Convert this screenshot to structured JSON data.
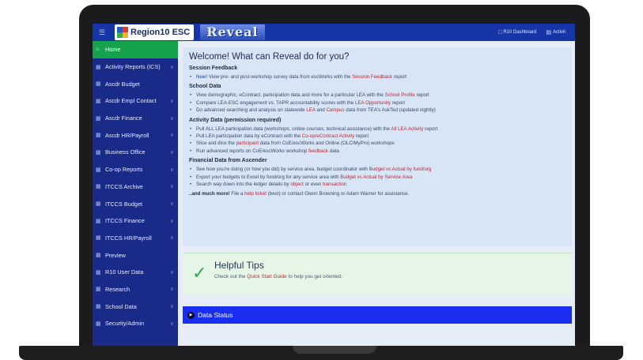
{
  "header": {
    "logo_text": "Region10 ESC",
    "brand": "Reveal",
    "links": [
      {
        "label": "R10 Dashboard",
        "icon": "dashboard-icon"
      },
      {
        "label": "Activit",
        "icon": "activity-icon"
      }
    ],
    "colors": {
      "header_bg": "#1636a8",
      "sidebar_bg": "#1a2a88",
      "active_green": "#14a34c",
      "link_red": "#c42630",
      "status_blue": "#1a2ef2"
    }
  },
  "sidebar": {
    "items": [
      {
        "label": "Home",
        "icon": "home-icon",
        "active": true
      },
      {
        "label": "Activity Reports (ICS)",
        "icon": "grid-icon",
        "chevron": true
      },
      {
        "label": "Ascdr Budget",
        "icon": "grid-icon",
        "chevron": false
      },
      {
        "label": "Ascdr Empl Contact",
        "icon": "grid-icon",
        "chevron": true
      },
      {
        "label": "Ascdr Finance",
        "icon": "grid-icon",
        "chevron": true
      },
      {
        "label": "Ascdr HR/Payroll",
        "icon": "grid-icon",
        "chevron": true
      },
      {
        "label": "Business Office",
        "icon": "grid-icon",
        "chevron": true
      },
      {
        "label": "Co-op Reports",
        "icon": "grid-icon",
        "chevron": true
      },
      {
        "label": "ITCCS Archive",
        "icon": "grid-icon",
        "chevron": true
      },
      {
        "label": "ITCCS Budget",
        "icon": "grid-icon",
        "chevron": true
      },
      {
        "label": "ITCCS Finance",
        "icon": "grid-icon",
        "chevron": true
      },
      {
        "label": "ITCCS HR/Payroll",
        "icon": "grid-icon",
        "chevron": true
      },
      {
        "label": "Preview",
        "icon": "grid-icon",
        "chevron": false
      },
      {
        "label": "R10 User Data",
        "icon": "grid-icon",
        "chevron": true
      },
      {
        "label": "Research",
        "icon": "grid-icon",
        "chevron": true
      },
      {
        "label": "School Data",
        "icon": "grid-icon",
        "chevron": true
      },
      {
        "label": "Security/Admin",
        "icon": "grid-icon",
        "chevron": true
      }
    ]
  },
  "welcome": {
    "title": "Welcome! What can Reveal do for you?",
    "sections": [
      {
        "heading": "Session Feedback",
        "items": [
          {
            "parts": [
              {
                "t": "New!",
                "s": "blue"
              },
              {
                "t": " View pre- and post-workshop survey data from escWorks with the "
              },
              {
                "t": "Session Feedback",
                "s": "red"
              },
              {
                "t": " report"
              }
            ]
          }
        ]
      },
      {
        "heading": "School Data",
        "items": [
          {
            "parts": [
              {
                "t": "View demographic, eContract, participation data and more for a particular LEA with the "
              },
              {
                "t": "School Profile",
                "s": "red"
              },
              {
                "t": " report"
              }
            ]
          },
          {
            "parts": [
              {
                "t": "Compare LEA-ESC engagement vs. TAPR accountability scores with the "
              },
              {
                "t": "LEA Opportunity",
                "s": "red"
              },
              {
                "t": " report"
              }
            ]
          },
          {
            "parts": [
              {
                "t": "Do advanced searching and analysis on statewide "
              },
              {
                "t": "LEA",
                "s": "red"
              },
              {
                "t": " and "
              },
              {
                "t": "Campus",
                "s": "red"
              },
              {
                "t": " data from TEA's AskTed (updated nightly)"
              }
            ]
          }
        ]
      },
      {
        "heading": "Activity Data (permission required)",
        "items": [
          {
            "parts": [
              {
                "t": "Pull ALL LEA participation data (workshops, online courses, technical assistance) with the "
              },
              {
                "t": "All LEA Activity",
                "s": "red"
              },
              {
                "t": " report"
              }
            ]
          },
          {
            "parts": [
              {
                "t": "Pull LEA participation data by eContract with the "
              },
              {
                "t": "Co-op/eContract Activity",
                "s": "red"
              },
              {
                "t": " report"
              }
            ]
          },
          {
            "parts": [
              {
                "t": "Slice and dice the "
              },
              {
                "t": "participant",
                "s": "red"
              },
              {
                "t": " data from CoE/escWorks and Online (OLC/MyPro) workshops"
              }
            ]
          },
          {
            "parts": [
              {
                "t": "Run advanced reports on CoE/escWorks workshop "
              },
              {
                "t": "feedback",
                "s": "red"
              },
              {
                "t": " data"
              }
            ]
          }
        ]
      },
      {
        "heading": "Financial Data from Ascender",
        "items": [
          {
            "parts": [
              {
                "t": "See how you're doing (or how you did) by service area, budget coordinator with "
              },
              {
                "t": "Budget vs Actual by fund/org",
                "s": "red"
              }
            ]
          },
          {
            "parts": [
              {
                "t": "Export your budgets to Excel by fund/org for any service area with "
              },
              {
                "t": "Budget vs Actual by Service Area",
                "s": "red"
              }
            ]
          },
          {
            "parts": [
              {
                "t": "Search way down into the ledger details by "
              },
              {
                "t": "object",
                "s": "red"
              },
              {
                "t": " or even "
              },
              {
                "t": "transaction",
                "s": "red"
              }
            ]
          }
        ]
      }
    ],
    "more": [
      {
        "t": "..and much more!",
        "s": "bold"
      },
      {
        "t": " File a "
      },
      {
        "t": "help ticket",
        "s": "red"
      },
      {
        "t": " (best) or contact Glenn Browning or Adam Warner for assistance."
      }
    ]
  },
  "tips": {
    "title": "Helpful Tips",
    "parts": [
      {
        "t": "Check out the "
      },
      {
        "t": "Quick Start Guide",
        "s": "red"
      },
      {
        "t": " to help you get oriented."
      }
    ],
    "icon": "checkmark-icon"
  },
  "data_status": {
    "label": "Data Status",
    "icon": "play-circle-icon"
  }
}
